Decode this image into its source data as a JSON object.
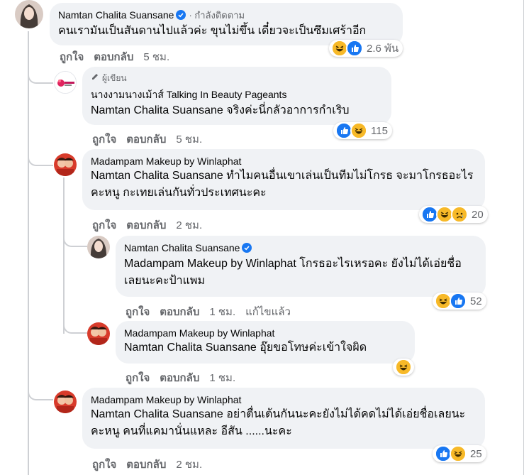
{
  "comments": [
    {
      "name": "Namtan Chalita Suansane",
      "follow": "· กำลังติดตาม",
      "text": "คนเรามันเป็นสันดานไปแล้วค่ะ ขุนไม่ขึ้น เดี๋ยวจะเป็นซึมเศร้าอีก",
      "like": "ถูกใจ",
      "reply": "ตอบกลับ",
      "time": "5 ชม.",
      "reaction_count": "2.6 พัน"
    },
    {
      "author_badge": "ผู้เขียน",
      "name": "นางงามนางเม้าส์ Talking In Beauty Pageants",
      "tag": "Namtan Chalita Suansane",
      "text": " จริงค่ะนี่กลัวอาการกำเริบ",
      "like": "ถูกใจ",
      "reply": "ตอบกลับ",
      "time": "5 ชม.",
      "reaction_count": "115"
    },
    {
      "name": "Madampam Makeup by Winlaphat",
      "tag": "Namtan Chalita Suansane",
      "text": " ทำไมคนอื่นเขาเล่นเป็นทีมไม่โกรธ จะมาโกรธอะไรคะหนู กะเทยเล่นกันทั่วประเทศนะคะ",
      "like": "ถูกใจ",
      "reply": "ตอบกลับ",
      "time": "2 ชม.",
      "reaction_count": "20"
    },
    {
      "name": "Namtan Chalita Suansane",
      "tag": "Madampam Makeup by Winlaphat",
      "text": " โกรธอะไรเหรอคะ ยังไม่ได้เอ่ยชื่อเลยนะคะป้าแพม",
      "like": "ถูกใจ",
      "reply": "ตอบกลับ",
      "time": "1 ชม.",
      "edited": "แก้ไขแล้ว",
      "reaction_count": "52"
    },
    {
      "name": "Madampam Makeup by Winlaphat",
      "tag": "Namtan Chalita Suansane",
      "text": " อุ๊ยขอโทษค่ะเข้าใจผิด",
      "like": "ถูกใจ",
      "reply": "ตอบกลับ",
      "time": "1 ชม."
    },
    {
      "name": "Madampam Makeup by Winlaphat",
      "tag": "Namtan Chalita Suansane",
      "text": " อย่าตื่นเต้นกันนะคะยังไม่ได้คดไม่ได้เอ่ยชื่อเลยนะคะหนู คนที่แคมานั่นแหละ อีสัน ......นะคะ",
      "like": "ถูกใจ",
      "reply": "ตอบกลับ",
      "time": "2 ชม.",
      "reaction_count": "25"
    }
  ],
  "icons": {
    "like": "like-icon",
    "haha": "haha-icon",
    "sad": "sad-icon",
    "verified": "verified-badge-icon",
    "author": "author-pen-icon"
  },
  "colors": {
    "like_blue": "#1877f2",
    "haha_yellow": "#f7b928",
    "bubble": "#f0f2f5",
    "meta_gray": "#65676b"
  }
}
